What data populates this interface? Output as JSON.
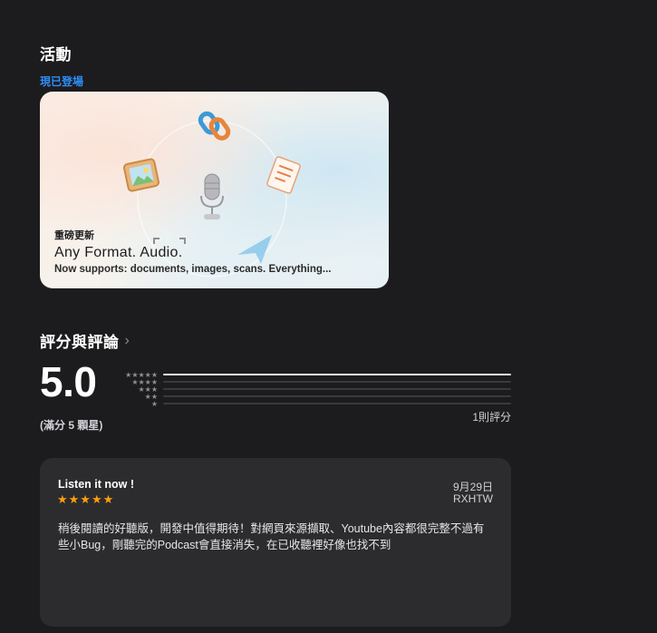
{
  "events": {
    "section_title": "活動",
    "status_label": "現已登場",
    "card": {
      "tag": "重磅更新",
      "title": "Any Format. Audio.",
      "subtitle": "Now supports: documents, images, scans. Everything...",
      "icons": [
        "link-icon",
        "image-icon",
        "microphone-icon",
        "document-icon",
        "scan-icon",
        "send-icon"
      ]
    }
  },
  "ratings": {
    "section_title": "評分與評論",
    "chevron": "›",
    "average": "5.0",
    "out_of": "(滿分 5 顆星)",
    "count_label": "1則評分",
    "distribution": [
      {
        "stars": 5,
        "fraction": 1.0
      },
      {
        "stars": 4,
        "fraction": 0
      },
      {
        "stars": 3,
        "fraction": 0
      },
      {
        "stars": 2,
        "fraction": 0
      },
      {
        "stars": 1,
        "fraction": 0
      }
    ]
  },
  "review": {
    "title": "Listen it now !",
    "stars": "★★★★★",
    "rating": 5,
    "date": "9月29日",
    "author": "RXHTW",
    "body": "稍後閱讀的好聽版，開發中值得期待！對網頁來源擷取、Youtube內容都很完整不過有些小Bug，剛聽完的Podcast會直接消失，在已收聽裡好像也找不到"
  },
  "colors": {
    "background": "#1c1c1e",
    "card_background": "#2c2c2e",
    "accent": "#2f8ef9",
    "star": "#ff9f0a"
  }
}
